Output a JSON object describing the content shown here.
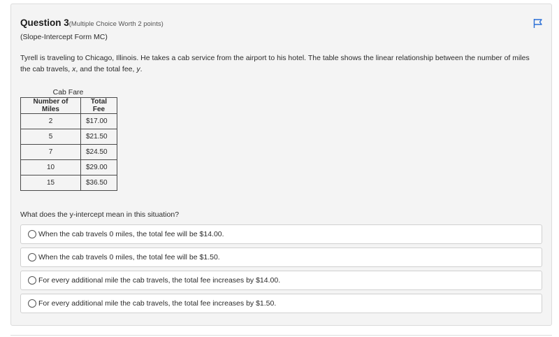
{
  "question": {
    "title": "Question 3",
    "points": "(Multiple Choice Worth 2 points)",
    "subtitle": "(Slope-Intercept Form MC)",
    "prompt_pre": "Tyrell is traveling to Chicago, Illinois. He takes a cab service from the airport to his hotel. The table shows the linear relationship between the number of miles the cab travels, ",
    "prompt_x": "x",
    "prompt_mid": ", and the total fee, ",
    "prompt_y": "y",
    "prompt_end": ".",
    "flag_icon": "flag-icon"
  },
  "table": {
    "caption": "Cab Fare",
    "headers": [
      "Number of Miles",
      "Total Fee"
    ],
    "rows": [
      [
        "2",
        "$17.00"
      ],
      [
        "5",
        "$21.50"
      ],
      [
        "7",
        "$24.50"
      ],
      [
        "10",
        "$29.00"
      ],
      [
        "15",
        "$36.50"
      ]
    ]
  },
  "ask": "What does the y-intercept mean in this situation?",
  "options": [
    "When the cab travels 0 miles, the total fee will be $14.00.",
    "When the cab travels 0 miles, the total fee will be $1.50.",
    "For every additional mile the cab travels, the total fee increases by $14.00.",
    "For every additional mile the cab travels, the total fee increases by $1.50."
  ],
  "colors": {
    "flag": "#2a6fd6",
    "card_bg": "#f4f4f4",
    "option_bg": "#ffffff"
  }
}
